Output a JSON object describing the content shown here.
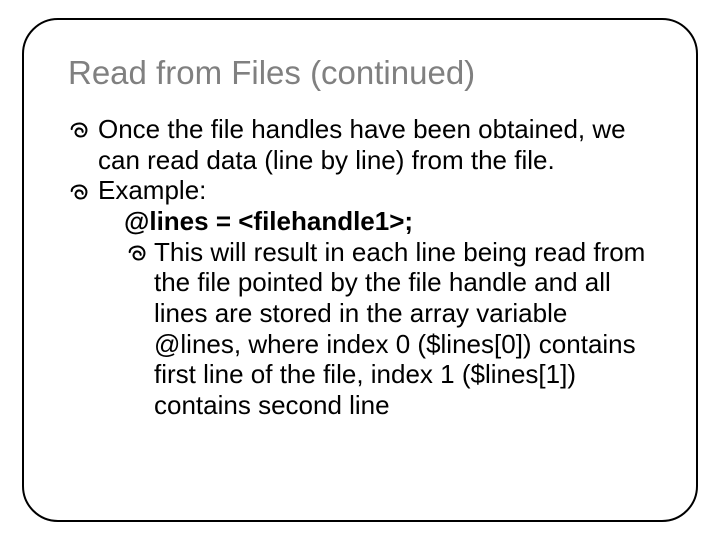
{
  "title": "Read from Files (continued)",
  "p1": "Once the file handles have been obtained, we can read data (line by line) from the file.",
  "p2": "Example:",
  "code": "@lines = <filehandle1>;",
  "p3": "This will result in each line being read from the file pointed by the file handle and all lines are stored in the array variable @lines, where index 0 ($lines[0]) contains first line of the file, index 1 ($lines[1]) contains second line"
}
